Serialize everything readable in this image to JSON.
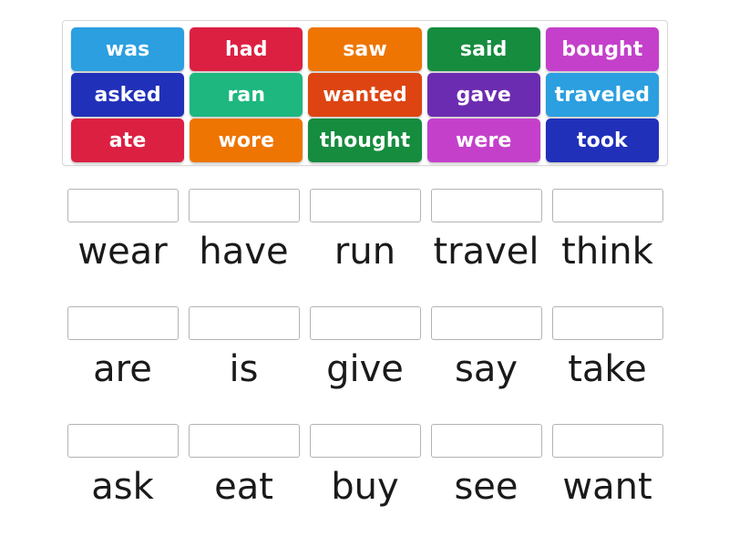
{
  "activity": {
    "type": "match-up",
    "tile_bank": {
      "rows": [
        [
          {
            "label": "was",
            "color": "#2b9fe0"
          },
          {
            "label": "had",
            "color": "#dc2042"
          },
          {
            "label": "saw",
            "color": "#ee7502"
          },
          {
            "label": "said",
            "color": "#168c3f"
          },
          {
            "label": "bought",
            "color": "#c440cb"
          }
        ],
        [
          {
            "label": "asked",
            "color": "#2130b9"
          },
          {
            "label": "ran",
            "color": "#1db77f"
          },
          {
            "label": "wanted",
            "color": "#dd4411"
          },
          {
            "label": "gave",
            "color": "#6c2cb1"
          },
          {
            "label": "traveled",
            "color": "#2b9fe0"
          }
        ],
        [
          {
            "label": "ate",
            "color": "#dc2042"
          },
          {
            "label": "wore",
            "color": "#ee7502"
          },
          {
            "label": "thought",
            "color": "#168c3f"
          },
          {
            "label": "were",
            "color": "#c440cb"
          },
          {
            "label": "took",
            "color": "#2130b9"
          }
        ]
      ]
    },
    "answer_rows": [
      [
        {
          "label": "wear",
          "dropped": ""
        },
        {
          "label": "have",
          "dropped": ""
        },
        {
          "label": "run",
          "dropped": ""
        },
        {
          "label": "travel",
          "dropped": ""
        },
        {
          "label": "think",
          "dropped": ""
        }
      ],
      [
        {
          "label": "are",
          "dropped": ""
        },
        {
          "label": "is",
          "dropped": ""
        },
        {
          "label": "give",
          "dropped": ""
        },
        {
          "label": "say",
          "dropped": ""
        },
        {
          "label": "take",
          "dropped": ""
        }
      ],
      [
        {
          "label": "ask",
          "dropped": ""
        },
        {
          "label": "eat",
          "dropped": ""
        },
        {
          "label": "buy",
          "dropped": ""
        },
        {
          "label": "see",
          "dropped": ""
        },
        {
          "label": "want",
          "dropped": ""
        }
      ]
    ],
    "colors": {
      "page_background": "#ffffff",
      "panel_border": "#d8d8d8",
      "drop_zone_border": "#b3b3b3",
      "label_text": "#1a1a1a",
      "tile_text": "#ffffff"
    }
  }
}
